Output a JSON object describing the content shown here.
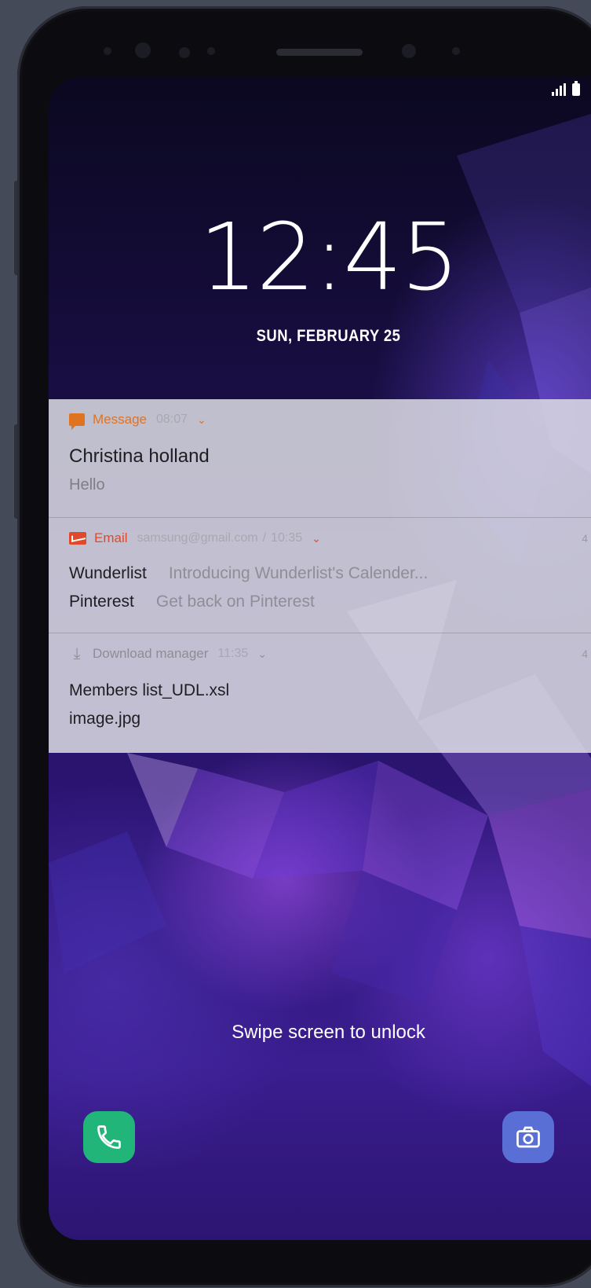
{
  "status_bar": {
    "signal_icon": "signal-icon",
    "battery_icon": "battery-icon"
  },
  "lockscreen": {
    "time": "12:45",
    "date": "SUN, FEBRUARY 25",
    "swipe_hint": "Swipe screen to unlock"
  },
  "notifications": [
    {
      "app": "Message",
      "time": "08:07",
      "icon": "message-icon",
      "color": "#e07320",
      "title": "Christina holland",
      "body": "Hello"
    },
    {
      "app": "Email",
      "account": "samsung@gmail.com",
      "separator": "/",
      "time": "10:35",
      "count": "4",
      "icon": "email-icon",
      "color": "#e04a2a",
      "rows": [
        {
          "sender": "Wunderlist",
          "preview": "Introducing Wunderlist's Calender..."
        },
        {
          "sender": "Pinterest",
          "preview": "Get back on Pinterest"
        }
      ]
    },
    {
      "app": "Download manager",
      "time": "11:35",
      "count": "4",
      "icon": "download-icon",
      "color": "#8d8d95",
      "title": "Members list_UDL.xsl",
      "body": "image.jpg"
    }
  ],
  "shortcuts": {
    "left": "phone-icon",
    "right": "camera-icon"
  },
  "colors": {
    "phone_shortcut": "#22b57a",
    "camera_shortcut": "#5a6fd6",
    "wallpaper": "#2a1470"
  }
}
